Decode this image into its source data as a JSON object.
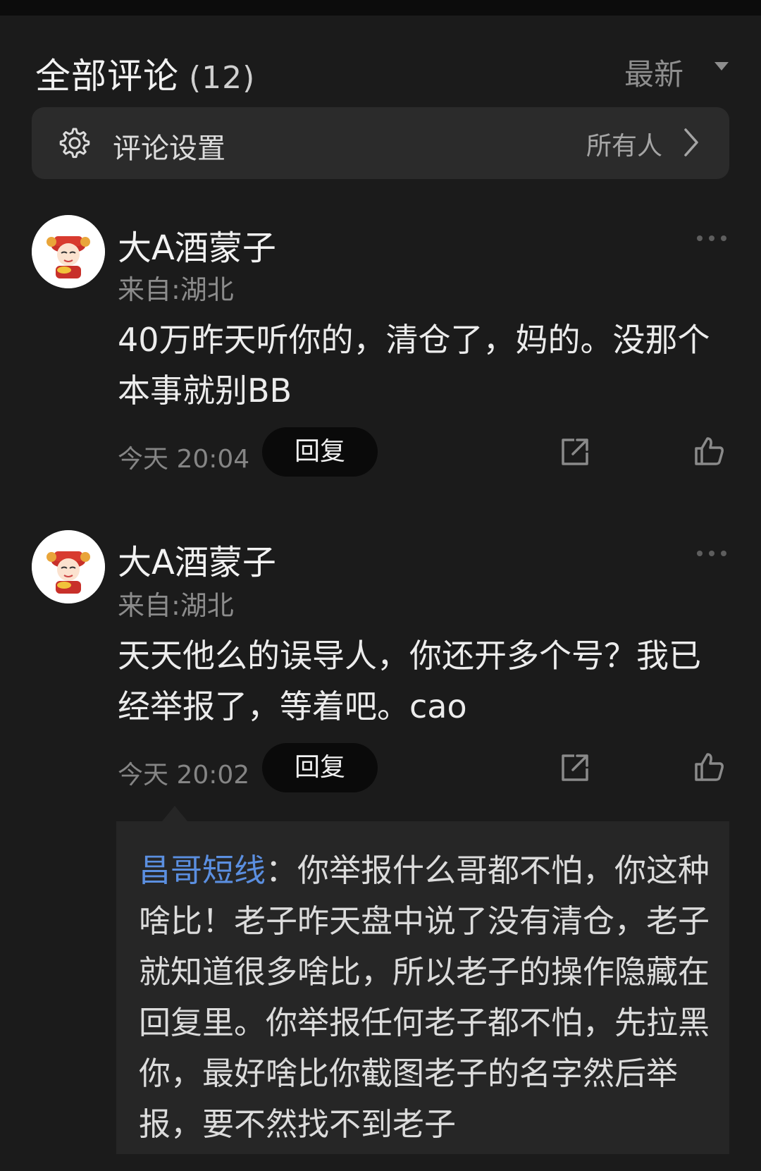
{
  "header": {
    "title": "全部评论",
    "count": "(12)",
    "sort_label": "最新"
  },
  "settings": {
    "label": "评论设置",
    "value": "所有人"
  },
  "comments": [
    {
      "username": "大A酒蒙子",
      "location": "来自:湖北",
      "text": "40万昨天听你的，清仓了，妈的。没那个本事就别BB",
      "time": "今天 20:04",
      "reply_label": "回复"
    },
    {
      "username": "大A酒蒙子",
      "location": "来自:湖北",
      "text": "天天他么的误导人，你还开多个号？我已经举报了，等着吧。cao",
      "time": "今天 20:02",
      "reply_label": "回复"
    }
  ],
  "reply": {
    "author": "昌哥短线",
    "separator": "：",
    "text": "你举报什么哥都不怕，你这种啥比！老子昨天盘中说了没有清仓，老子就知道很多啥比，所以老子的操作隐藏在回复里。你举报任何老子都不怕，先拉黑你，最好啥比你截图老子的名字然后举报，要不然找不到老子"
  },
  "colors": {
    "background": "#1b1b1b",
    "settings_bg": "#2b2b2b",
    "reply_bg": "#262626",
    "author_link": "#5b8fe0"
  },
  "icons": [
    "gear-icon",
    "chevron-right-icon",
    "chevron-down-icon",
    "more-icon",
    "share-icon",
    "thumbs-up-icon"
  ]
}
